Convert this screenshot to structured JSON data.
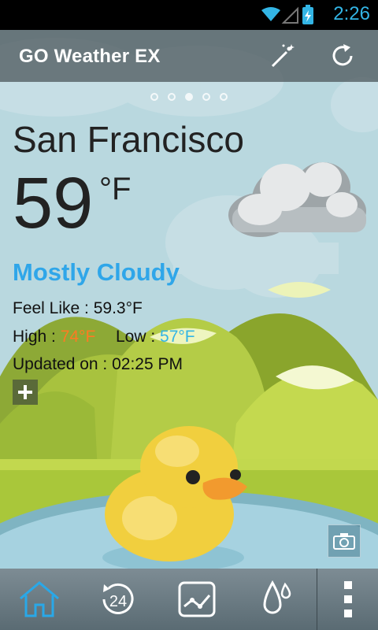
{
  "status_bar": {
    "time": "2:26"
  },
  "app": {
    "title": "GO Weather EX"
  },
  "pager": {
    "count": 5,
    "active": 2
  },
  "weather": {
    "city": "San Francisco",
    "temperature": "59",
    "unit": "°F",
    "condition": "Mostly Cloudy",
    "feel_like_label": "Feel Like : ",
    "feel_like_value": "59.3°F",
    "high_label": "High : ",
    "high_value": "74°F",
    "low_label": "Low : ",
    "low_value": "57°F",
    "updated_label": "Updated on : ",
    "updated_value": "02:25 PM"
  },
  "bottom_nav": {
    "items": [
      {
        "icon": "home-icon"
      },
      {
        "icon": "24-hour-icon",
        "label": "24"
      },
      {
        "icon": "trend-chart-icon"
      },
      {
        "icon": "precipitation-icon"
      }
    ],
    "menu_icon": "overflow-menu-icon"
  },
  "colors": {
    "accent": "#33b5e5",
    "high": "#ff7a22",
    "condition": "#2fa6e9"
  }
}
